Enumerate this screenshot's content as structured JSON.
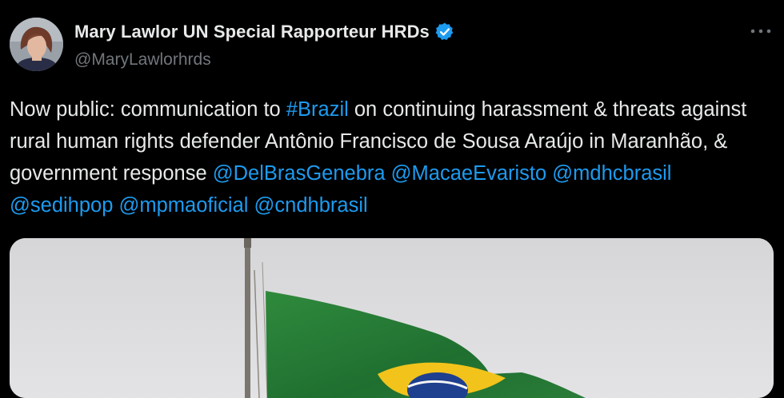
{
  "author": {
    "display_name": "Mary Lawlor UN Special Rapporteur HRDs",
    "handle": "@MaryLawlorhrds",
    "verified": true,
    "avatar_icon": "profile-photo"
  },
  "more_icon": "ellipsis-icon",
  "tweet": {
    "segments": [
      {
        "text": "Now public: communication to ",
        "link": false
      },
      {
        "text": "#Brazil",
        "link": true
      },
      {
        "text": " on continuing harassment & threats against rural human rights defender Antônio Francisco de Sousa Araújo in Maranhão, & government response ",
        "link": false
      },
      {
        "text": "@DelBrasGenebra",
        "link": true
      },
      {
        "text": " ",
        "link": false
      },
      {
        "text": "@MacaeEvaristo",
        "link": true
      },
      {
        "text": " ",
        "link": false
      },
      {
        "text": "@mdhcbrasil",
        "link": true
      },
      {
        "text": " ",
        "link": false
      },
      {
        "text": "@sedihpop",
        "link": true
      },
      {
        "text": " ",
        "link": false
      },
      {
        "text": "@mpmaoficial",
        "link": true
      },
      {
        "text": " ",
        "link": false
      },
      {
        "text": "@cndhbrasil",
        "link": true
      }
    ]
  },
  "media": {
    "kind": "photo",
    "subject": "brazil-flag-on-pole"
  },
  "colors": {
    "background": "#000000",
    "text": "#e7e9ea",
    "muted": "#71767b",
    "link": "#1d9bf0",
    "verified": "#1d9bf0"
  }
}
